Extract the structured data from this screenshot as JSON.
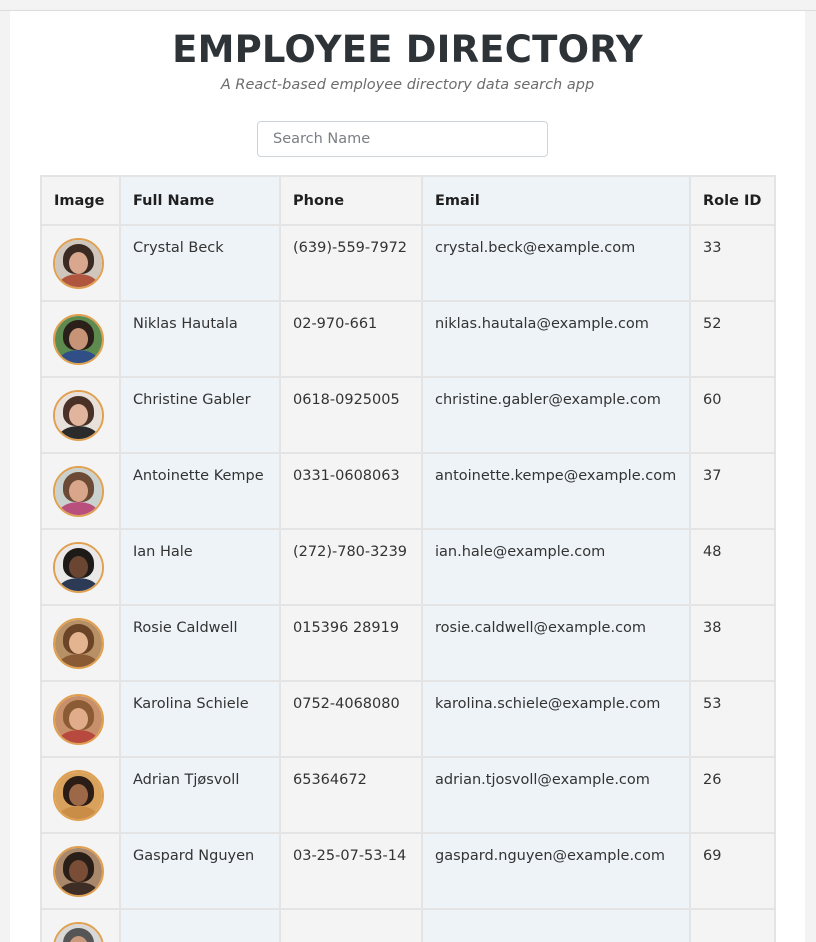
{
  "header": {
    "title": "EMPLOYEE DIRECTORY",
    "subtitle": "A React-based employee directory data search app"
  },
  "search": {
    "placeholder": "Search Name",
    "value": ""
  },
  "table": {
    "headers": {
      "image": "Image",
      "name": "Full Name",
      "phone": "Phone",
      "email": "Email",
      "role": "Role ID"
    },
    "rows": [
      {
        "name": "Crystal Beck",
        "phone": "(639)-559-7972",
        "email": "crystal.beck@example.com",
        "role": "33",
        "avatar": {
          "bg": "#cfc7bd",
          "hair": "#3a2a22",
          "skin": "#d9a78e",
          "shirt": "#b0563e"
        }
      },
      {
        "name": "Niklas Hautala",
        "phone": "02-970-661",
        "email": "niklas.hautala@example.com",
        "role": "52",
        "avatar": {
          "bg": "#5d8a4f",
          "hair": "#2a2019",
          "skin": "#c79477",
          "shirt": "#2f4f86"
        }
      },
      {
        "name": "Christine Gabler",
        "phone": "0618-0925005",
        "email": "christine.gabler@example.com",
        "role": "60",
        "avatar": {
          "bg": "#e8e0db",
          "hair": "#4a3128",
          "skin": "#e1b49d",
          "shirt": "#2b2b2b"
        }
      },
      {
        "name": "Antoinette Kempe",
        "phone": "0331-0608063",
        "email": "antoinette.kempe@example.com",
        "role": "37",
        "avatar": {
          "bg": "#c9d2cf",
          "hair": "#6b4a36",
          "skin": "#d9a58b",
          "shirt": "#b94f7c"
        }
      },
      {
        "name": "Ian Hale",
        "phone": "(272)-780-3239",
        "email": "ian.hale@example.com",
        "role": "48",
        "avatar": {
          "bg": "#e9e9e9",
          "hair": "#1e1a18",
          "skin": "#6a4532",
          "shirt": "#2c3a55"
        }
      },
      {
        "name": "Rosie Caldwell",
        "phone": "015396 28919",
        "email": "rosie.caldwell@example.com",
        "role": "38",
        "avatar": {
          "bg": "#b89065",
          "hair": "#6b4428",
          "skin": "#e3b48f",
          "shirt": "#8a5a35"
        }
      },
      {
        "name": "Karolina Schiele",
        "phone": "0752-4068080",
        "email": "karolina.schiele@example.com",
        "role": "53",
        "avatar": {
          "bg": "#c88f6b",
          "hair": "#8a5b35",
          "skin": "#e0ac8a",
          "shirt": "#b8493e"
        }
      },
      {
        "name": "Adrian Tjøsvoll",
        "phone": "65364672",
        "email": "adrian.tjosvoll@example.com",
        "role": "26",
        "avatar": {
          "bg": "#d9a25c",
          "hair": "#2b1d16",
          "skin": "#9c6848",
          "shirt": "#c98d47"
        }
      },
      {
        "name": "Gaspard Nguyen",
        "phone": "03-25-07-53-14",
        "email": "gaspard.nguyen@example.com",
        "role": "69",
        "avatar": {
          "bg": "#a9876a",
          "hair": "#2a1e18",
          "skin": "#7a4d36",
          "shirt": "#3d2d25"
        }
      },
      {
        "name": "",
        "phone": "",
        "email": "",
        "role": "",
        "avatar": {
          "bg": "#d8d8d8",
          "hair": "#555555",
          "skin": "#c99a7e",
          "shirt": "#666666"
        }
      }
    ]
  }
}
